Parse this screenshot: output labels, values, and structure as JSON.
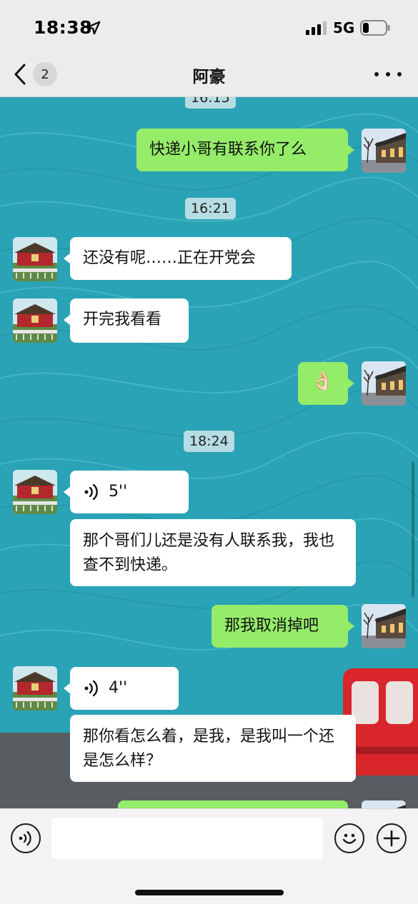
{
  "status": {
    "time": "18:38",
    "network": "5G"
  },
  "nav": {
    "back_count": "2",
    "title": "阿豪"
  },
  "timestamps": [
    "16:15",
    "16:21",
    "18:24"
  ],
  "messages": [
    {
      "side": "out",
      "type": "text",
      "text": "快递小哥有联系你了么"
    },
    {
      "side": "in",
      "type": "text",
      "text": "还没有呢……正在开党会"
    },
    {
      "side": "in",
      "type": "text",
      "text": "开完我看看"
    },
    {
      "side": "out",
      "type": "emoji",
      "text": "👌🏻"
    },
    {
      "side": "in",
      "type": "voice",
      "text": "5''"
    },
    {
      "side": "in",
      "type": "voice_text",
      "text": "那个哥们儿还是没有人联系我，我也查不到快递。"
    },
    {
      "side": "out",
      "type": "text",
      "text": "那我取消掉吧"
    },
    {
      "side": "in",
      "type": "voice",
      "text": "4''"
    },
    {
      "side": "in",
      "type": "voice_text",
      "text": "那你看怎么着，是我，是我叫一个还是怎么样？"
    }
  ],
  "input": {
    "placeholder": ""
  },
  "icons": {
    "back": "chevron-left-icon",
    "more": "more-dots-icon",
    "voice_toggle": "voice-icon",
    "emoji": "emoji-icon",
    "add": "plus-icon",
    "voice_wave": "voice-wave-icon"
  },
  "colors": {
    "chat_background": "#29a3b5",
    "outgoing_bubble": "#95ec69",
    "incoming_bubble": "#ffffff",
    "timestamp_bg": "#b6dde3"
  }
}
